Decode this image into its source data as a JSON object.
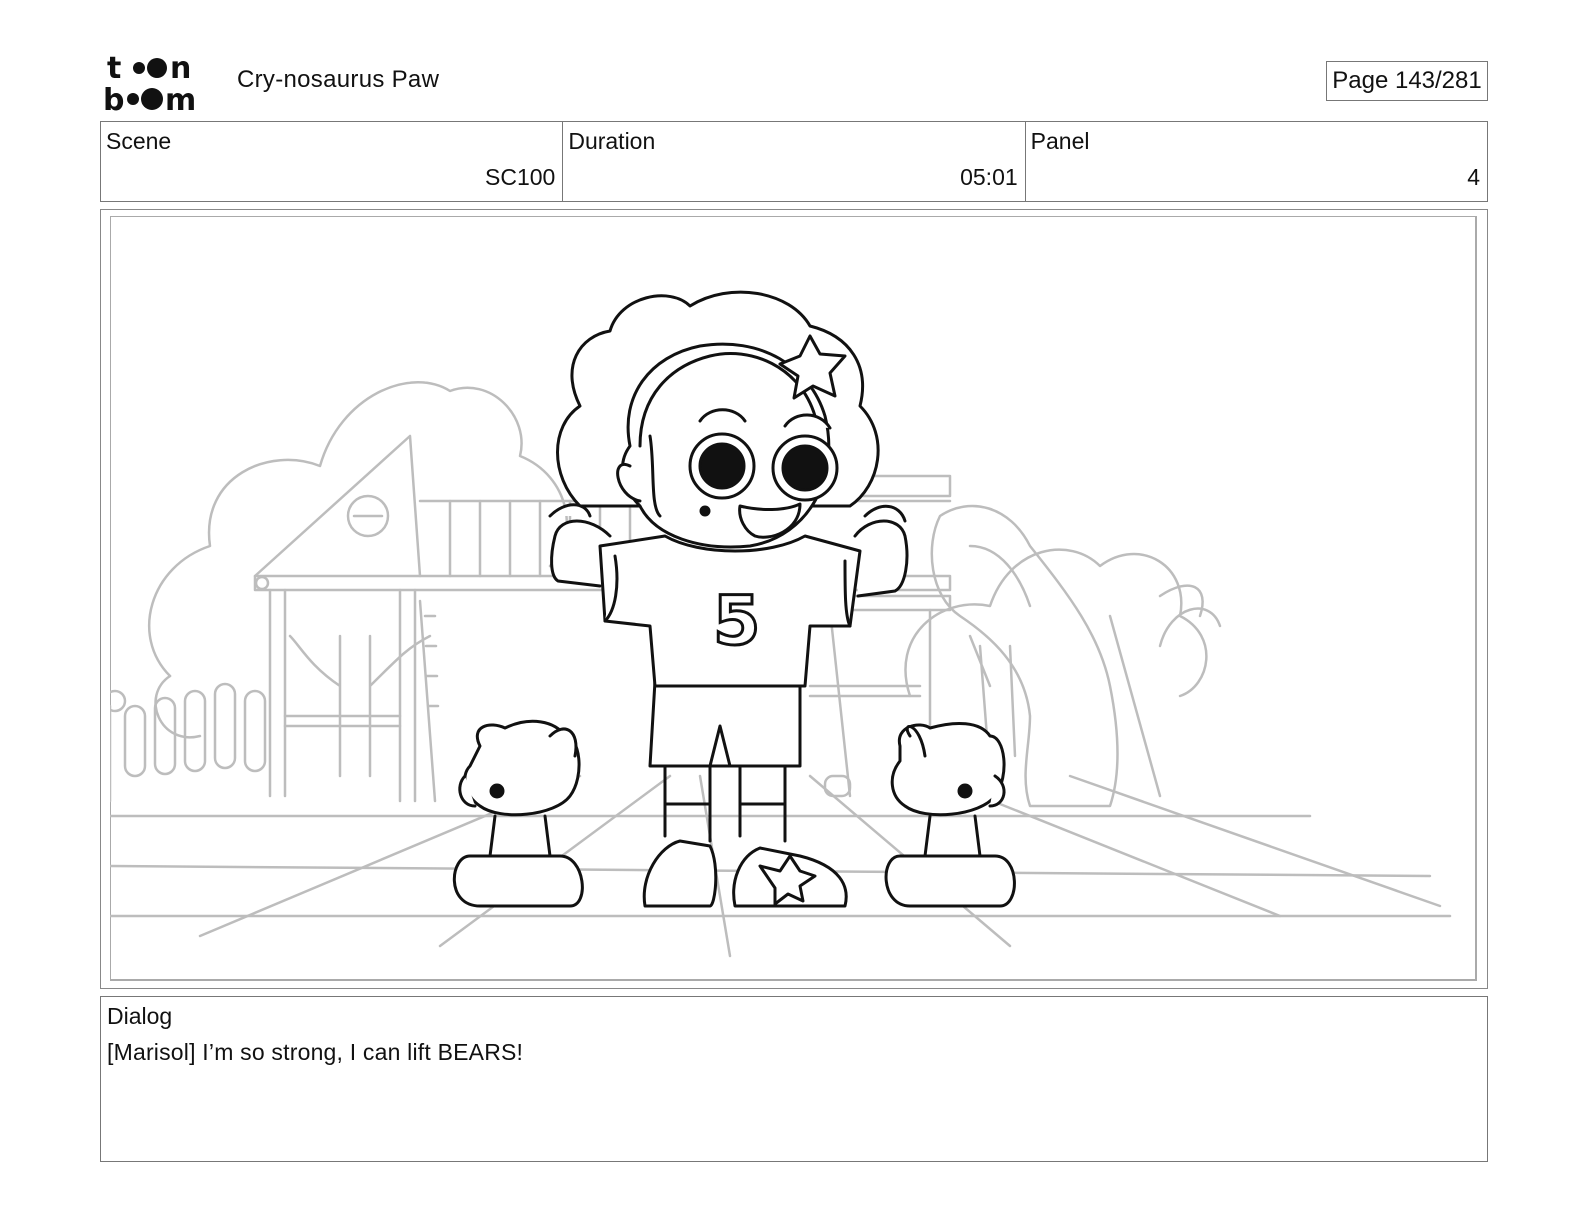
{
  "header": {
    "logo_text": "toon boom",
    "project_title": "Cry-nosaurus Paw",
    "page_label": "Page 143/281"
  },
  "info": {
    "scene_label": "Scene",
    "scene_value": "SC100",
    "duration_label": "Duration",
    "duration_value": "05:01",
    "panel_label": "Panel",
    "panel_value": "4"
  },
  "dialog": {
    "label": "Dialog",
    "text": "[Marisol] I’m so strong, I can lift BEARS!"
  },
  "panel_art": {
    "jersey_number": "5",
    "line_color": "#111111",
    "background_line_color": "#bdbdbd"
  }
}
